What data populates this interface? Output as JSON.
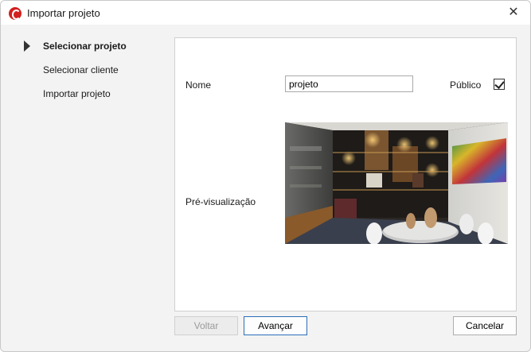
{
  "window": {
    "title": "Importar projeto",
    "close_glyph": "✕"
  },
  "steps": [
    {
      "label": "Selecionar projeto",
      "active": true
    },
    {
      "label": "Selecionar cliente",
      "active": false
    },
    {
      "label": "Importar projeto",
      "active": false
    }
  ],
  "form": {
    "name_label": "Nome",
    "name_value": "projeto",
    "public_label": "Público",
    "public_checked": true,
    "preview_label": "Pré-visualização"
  },
  "buttons": {
    "back": "Voltar",
    "next": "Avançar",
    "cancel": "Cancelar"
  },
  "colors": {
    "accent": "#2b6fb8",
    "app_icon": "#d21f1f"
  }
}
